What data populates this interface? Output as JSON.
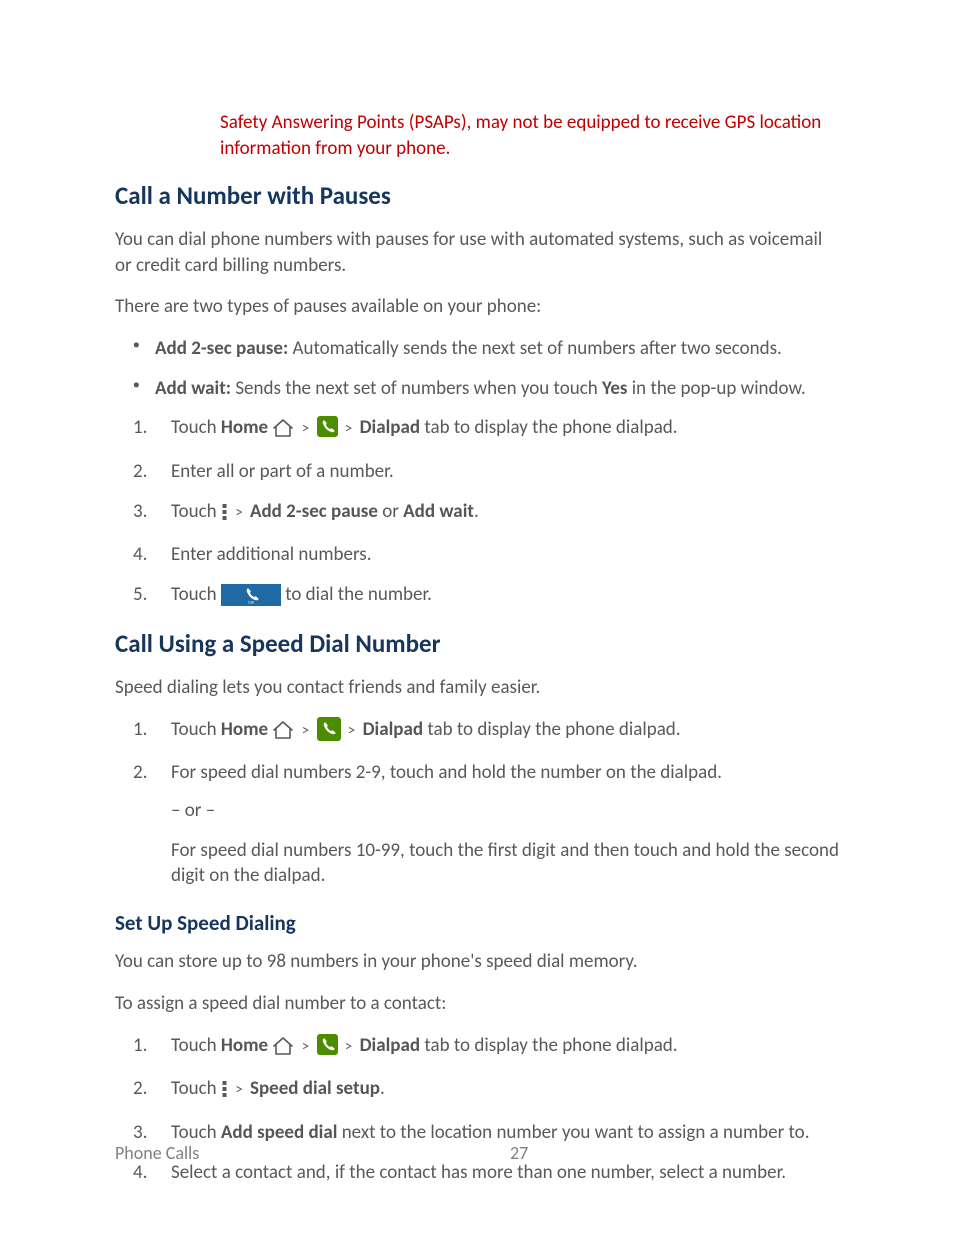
{
  "warning": "Safety Answering Points (PSAPs), may not be equipped to receive GPS location information from your phone.",
  "h_pauses": "Call a Number with Pauses",
  "p_pauses_intro": "You can dial phone numbers with pauses for use with automated systems, such as voicemail or credit card billing numbers.",
  "p_pauses_types": "There are two types of pauses available on your phone:",
  "bul_a_bold": "Add 2-sec pause:",
  "bul_a_rest": " Automatically sends the next set of numbers after two seconds.",
  "bul_b_bold": "Add wait:",
  "bul_b_rest_a": " Sends the next set of numbers when you touch ",
  "bul_b_yes": "Yes",
  "bul_b_rest_b": " in the pop-up window.",
  "s1_touch": "Touch ",
  "s1_home": "Home",
  "s1_gt": ">",
  "s1_dialpad": "Dialpad",
  "s1_rest": " tab to display the phone dialpad.",
  "s2": "Enter all or part of a number.",
  "s3_touch": "Touch ",
  "s3_add2": "Add 2-sec pause",
  "s3_or": " or ",
  "s3_addw": "Add wait",
  "s3_period": ".",
  "s4": "Enter additional numbers.",
  "s5_touch": "Touch ",
  "s5_rest": " to dial the number.",
  "h_speed": "Call Using a Speed Dial Number",
  "p_speed_intro": "Speed dialing lets you contact friends and family easier.",
  "sd2": "For speed dial numbers 2-9, touch and hold the number on the dialpad.",
  "sd_or": "– or –",
  "sd_long": "For speed dial numbers 10-99, touch the first digit and then touch and hold the second digit on the dialpad.",
  "h_setup": "Set Up Speed Dialing",
  "p_setup_intro": "You can store up to 98 numbers in your phone's speed dial memory.",
  "p_setup_assign": "To assign a speed dial number to a contact:",
  "su2_touch": "Touch ",
  "su2_sds": "Speed dial setup",
  "su3_a": "Touch ",
  "su3_bold": "Add speed dial",
  "su3_b": " next to the location number you want to assign a number to.",
  "su4": "Select a contact and, if the contact has more than one number, select a number.",
  "footer_section": "Phone Calls",
  "footer_page": "27"
}
